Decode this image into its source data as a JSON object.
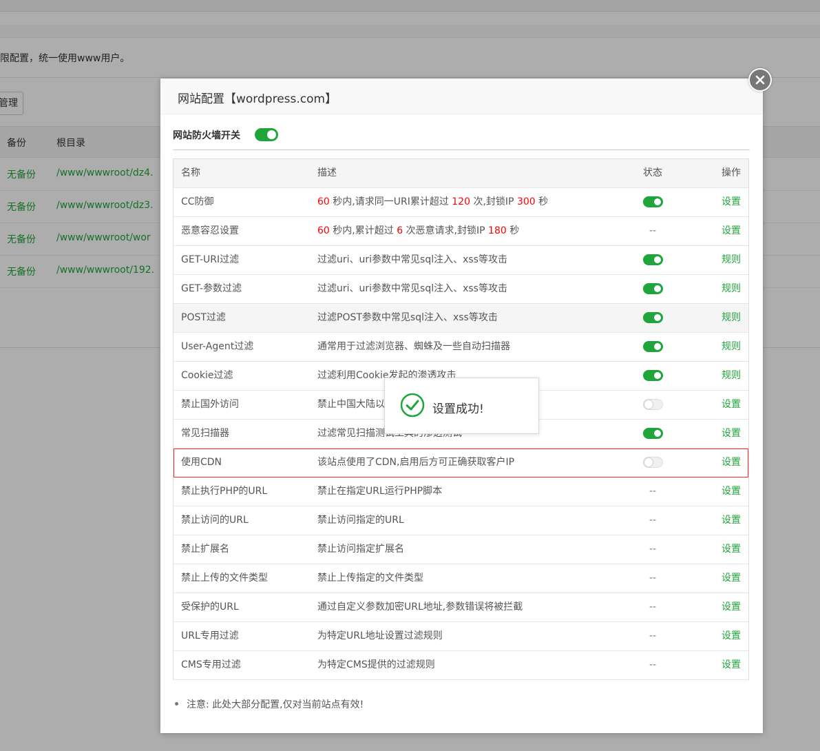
{
  "background": {
    "tip": "限配置，统一使用www用户。",
    "manage_button": "管理",
    "headers": {
      "backup": "备份",
      "root": "根目录"
    },
    "rows": [
      {
        "backup": "无备份",
        "root": "/www/wwwroot/dz4."
      },
      {
        "backup": "无备份",
        "root": "/www/wwwroot/dz3."
      },
      {
        "backup": "无备份",
        "root": "/www/wwwroot/wor"
      },
      {
        "backup": "无备份",
        "root": "/www/wwwroot/192."
      }
    ]
  },
  "modal": {
    "title": "网站配置【wordpress.com】",
    "firewall_switch_label": "网站防火墙开关",
    "firewall_enabled": true,
    "table": {
      "headers": {
        "name": "名称",
        "desc": "描述",
        "status": "状态",
        "action": "操作"
      },
      "rows": [
        {
          "name": "CC防御",
          "desc_parts": [
            "60",
            " 秒内,请求同一URI累计超过 ",
            "120",
            " 次,封锁IP ",
            "300",
            " 秒"
          ],
          "status": "on",
          "action": "设置"
        },
        {
          "name": "恶意容忍设置",
          "desc_parts": [
            "60",
            " 秒内,累计超过 ",
            "6",
            " 次恶意请求,封锁IP ",
            "180",
            " 秒"
          ],
          "status": "--",
          "action": "设置"
        },
        {
          "name": "GET-URI过滤",
          "desc": "过滤uri、uri参数中常见sql注入、xss等攻击",
          "status": "on",
          "action": "规则"
        },
        {
          "name": "GET-参数过滤",
          "desc": "过滤uri、uri参数中常见sql注入、xss等攻击",
          "status": "on",
          "action": "规则"
        },
        {
          "name": "POST过滤",
          "desc": "过滤POST参数中常见sql注入、xss等攻击",
          "status": "on",
          "action": "规则"
        },
        {
          "name": "User-Agent过滤",
          "desc": "通常用于过滤浏览器、蜘蛛及一些自动扫描器",
          "status": "on",
          "action": "规则"
        },
        {
          "name": "Cookie过滤",
          "desc": "过滤利用Cookie发起的渗透攻击",
          "status": "on",
          "action": "规则"
        },
        {
          "name": "禁止国外访问",
          "desc": "禁止中国大陆以外的地区访问站点",
          "status": "off",
          "action": "设置"
        },
        {
          "name": "常见扫描器",
          "desc": "过滤常见扫描测试工具的渗透测试",
          "status": "on",
          "action": "设置"
        },
        {
          "name": "使用CDN",
          "desc": "该站点使用了CDN,启用后方可正确获取客户IP",
          "status": "off",
          "action": "设置"
        },
        {
          "name": "禁止执行PHP的URL",
          "desc": "禁止在指定URL运行PHP脚本",
          "status": "--",
          "action": "设置"
        },
        {
          "name": "禁止访问的URL",
          "desc": "禁止访问指定的URL",
          "status": "--",
          "action": "设置"
        },
        {
          "name": "禁止扩展名",
          "desc": "禁止访问指定扩展名",
          "status": "--",
          "action": "设置"
        },
        {
          "name": "禁止上传的文件类型",
          "desc": "禁止上传指定的文件类型",
          "status": "--",
          "action": "设置"
        },
        {
          "name": "受保护的URL",
          "desc": "通过自定义参数加密URL地址,参数错误将被拦截",
          "status": "--",
          "action": "设置"
        },
        {
          "name": "URL专用过滤",
          "desc": "为特定URL地址设置过滤规则",
          "status": "--",
          "action": "设置"
        },
        {
          "name": "CMS专用过滤",
          "desc": "为特定CMS提供的过滤规则",
          "status": "--",
          "action": "设置"
        }
      ]
    },
    "note": "注意: 此处大部分配置,仅对当前站点有效!"
  },
  "toast": {
    "message": "设置成功!"
  },
  "icons": {
    "close": "close-icon",
    "success": "check-circle-icon"
  },
  "colors": {
    "accent_green": "#20a53a",
    "number_red": "#ff0000",
    "selected_row_border": "#ee3333"
  }
}
